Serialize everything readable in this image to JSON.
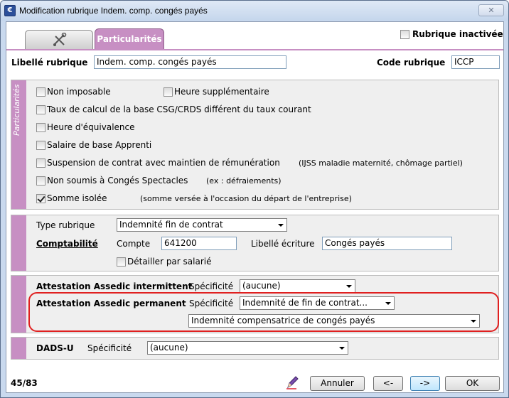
{
  "window": {
    "title": "Modification rubrique Indem. comp. congés payés",
    "close_label": "✕"
  },
  "tabs": {
    "icon_tab": "settings-tab",
    "particularites": "Particularités"
  },
  "header": {
    "inactive_label": "Rubrique inactivée",
    "inactive_checked": false,
    "libelle_label": "Libellé rubrique",
    "libelle_value": "Indem. comp. congés payés",
    "code_label": "Code rubrique",
    "code_value": "ICCP"
  },
  "particularites": {
    "section_label": "Particularités",
    "items": [
      {
        "label": "Non imposable",
        "checked": false,
        "note": ""
      },
      {
        "label": "Heure supplémentaire",
        "checked": false,
        "note": ""
      },
      {
        "label": "Taux de calcul de la base CSG/CRDS différent du taux courant",
        "checked": false,
        "note": ""
      },
      {
        "label": "Heure d'équivalence",
        "checked": false,
        "note": ""
      },
      {
        "label": "Salaire de base Apprenti",
        "checked": false,
        "note": ""
      },
      {
        "label": "Suspension de contrat avec maintien de rémunération",
        "checked": false,
        "note": "(IJSS maladie maternité, chômage partiel)"
      },
      {
        "label": "Non soumis à Congés Spectacles",
        "checked": false,
        "note": "(ex : défraiements)"
      },
      {
        "label": "Somme isolée",
        "checked": true,
        "note": "(somme versée à l'occasion du départ de l'entreprise)"
      }
    ]
  },
  "type_section": {
    "type_label": "Type rubrique",
    "type_value": "Indemnité fin de contrat",
    "comptabilite_label": "Comptabilité",
    "compte_label": "Compte",
    "compte_value": "641200",
    "libelle_ecriture_label": "Libellé écriture",
    "libelle_ecriture_value": "Congés payés",
    "detail_label": "Détailler par salarié",
    "detail_checked": false
  },
  "assedic": {
    "intermittent_label": "Attestation Assedic intermittent",
    "intermittent_spec_label": "Spécificité",
    "intermittent_spec_value": "(aucune)",
    "permanent_label": "Attestation Assedic permanent",
    "permanent_spec_label": "Spécificité",
    "permanent_spec_value": "Indemnité de fin de contrat...",
    "permanent_sub_value": "Indemnité compensatrice de congés payés"
  },
  "dads": {
    "label": "DADS-U",
    "spec_label": "Spécificité",
    "spec_value": "(aucune)"
  },
  "footer": {
    "counter": "45/83",
    "cancel_label": "Annuler",
    "prev_label": "<-",
    "next_label": "->",
    "ok_label": "OK"
  },
  "colors": {
    "accent": "#c78fc3",
    "highlight": "#e02020"
  }
}
